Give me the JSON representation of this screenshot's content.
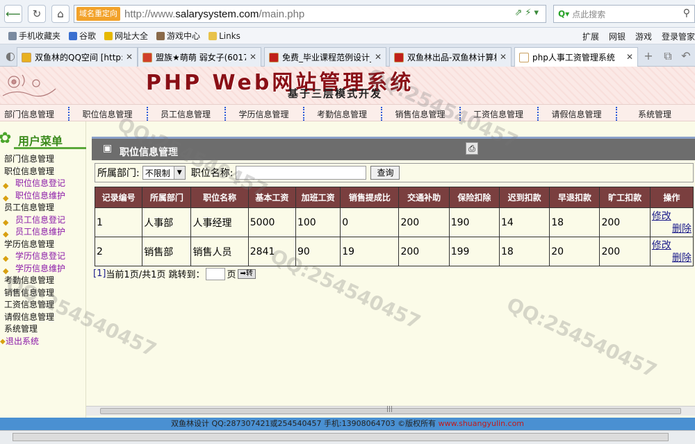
{
  "browser": {
    "address_tag": "域名重定向",
    "url_prefix": "http://www.",
    "url_domain": "salarysystem.com",
    "url_path": "/main.php",
    "search_placeholder": "点此搜索",
    "bookmarks": [
      {
        "label": "手机收藏夹",
        "color": "#7a8aa0"
      },
      {
        "label": "谷歌",
        "color": "#3a6fd0"
      },
      {
        "label": "网址大全",
        "color": "#e6b800"
      },
      {
        "label": "游戏中心",
        "color": "#8a6a4a"
      },
      {
        "label": "Links",
        "color": "#e8c24a"
      }
    ],
    "bookmarks_right": [
      "扩展",
      "网银",
      "游戏",
      "登录管家"
    ],
    "tabs": [
      {
        "title": "双鱼林的QQ空间 [http://",
        "color": "#e8b020",
        "active": false
      },
      {
        "title": "盟族★萌萌 弱女子(6017",
        "color": "#d0402a",
        "active": false
      },
      {
        "title": "免费_毕业课程范例设计_",
        "color": "#c0201a",
        "active": false
      },
      {
        "title": "双鱼林出品-双鱼林计算机",
        "color": "#c0201a",
        "active": false
      },
      {
        "title": "php人事工资管理系统",
        "color": "#ffffff",
        "active": true
      }
    ]
  },
  "banner": {
    "title": "PHP Web网站管理系统",
    "subtitle": "基于三层模式开发"
  },
  "topnav": [
    "部门信息管理",
    "职位信息管理",
    "员工信息管理",
    "学历信息管理",
    "考勤信息管理",
    "销售信息管理",
    "工资信息管理",
    "请假信息管理",
    "系统管理"
  ],
  "sidebar": {
    "header": "用户菜单",
    "items": [
      {
        "label": "部门信息管理",
        "level": 1
      },
      {
        "label": "职位信息管理",
        "level": 1
      },
      {
        "label": "职位信息登记",
        "level": 2
      },
      {
        "label": "职位信息维护",
        "level": 2
      },
      {
        "label": "员工信息管理",
        "level": 1
      },
      {
        "label": "员工信息登记",
        "level": 2
      },
      {
        "label": "员工信息维护",
        "level": 2
      },
      {
        "label": "学历信息管理",
        "level": 1
      },
      {
        "label": "学历信息登记",
        "level": 2
      },
      {
        "label": "学历信息维护",
        "level": 2
      },
      {
        "label": "考勤信息管理",
        "level": 1
      },
      {
        "label": "销售信息管理",
        "level": 1
      },
      {
        "label": "工资信息管理",
        "level": 1
      },
      {
        "label": "请假信息管理",
        "level": 1
      },
      {
        "label": "系统管理",
        "level": 1
      },
      {
        "label": "退出系统",
        "level": 0
      }
    ]
  },
  "main": {
    "title": "职位信息管理",
    "filter": {
      "dept_label": "所属部门:",
      "dept_value": "不限制",
      "name_label": "职位名称:",
      "query_button": "查询"
    },
    "columns": [
      "记录编号",
      "所属部门",
      "职位名称",
      "基本工资",
      "加班工资",
      "销售提成比",
      "交通补助",
      "保险扣除",
      "迟到扣款",
      "早退扣款",
      "旷工扣款",
      "操作"
    ],
    "rows": [
      [
        "1",
        "人事部",
        "人事经理",
        "5000",
        "100",
        "0",
        "200",
        "190",
        "14",
        "18",
        "200"
      ],
      [
        "2",
        "销售部",
        "销售人员",
        "2841",
        "90",
        "19",
        "200",
        "199",
        "18",
        "20",
        "200"
      ]
    ],
    "row_actions": {
      "edit": "修改",
      "delete": "删除"
    },
    "pager": {
      "page_link": "[1]",
      "status": "当前1页/共1页 跳转到：",
      "unit": "页",
      "go": "➡转"
    }
  },
  "footer": {
    "text": "双鱼林设计 QQ:287307421或254540457 手机:13908064703 ©版权所有 ",
    "site": "www.shuangyulin.com"
  }
}
